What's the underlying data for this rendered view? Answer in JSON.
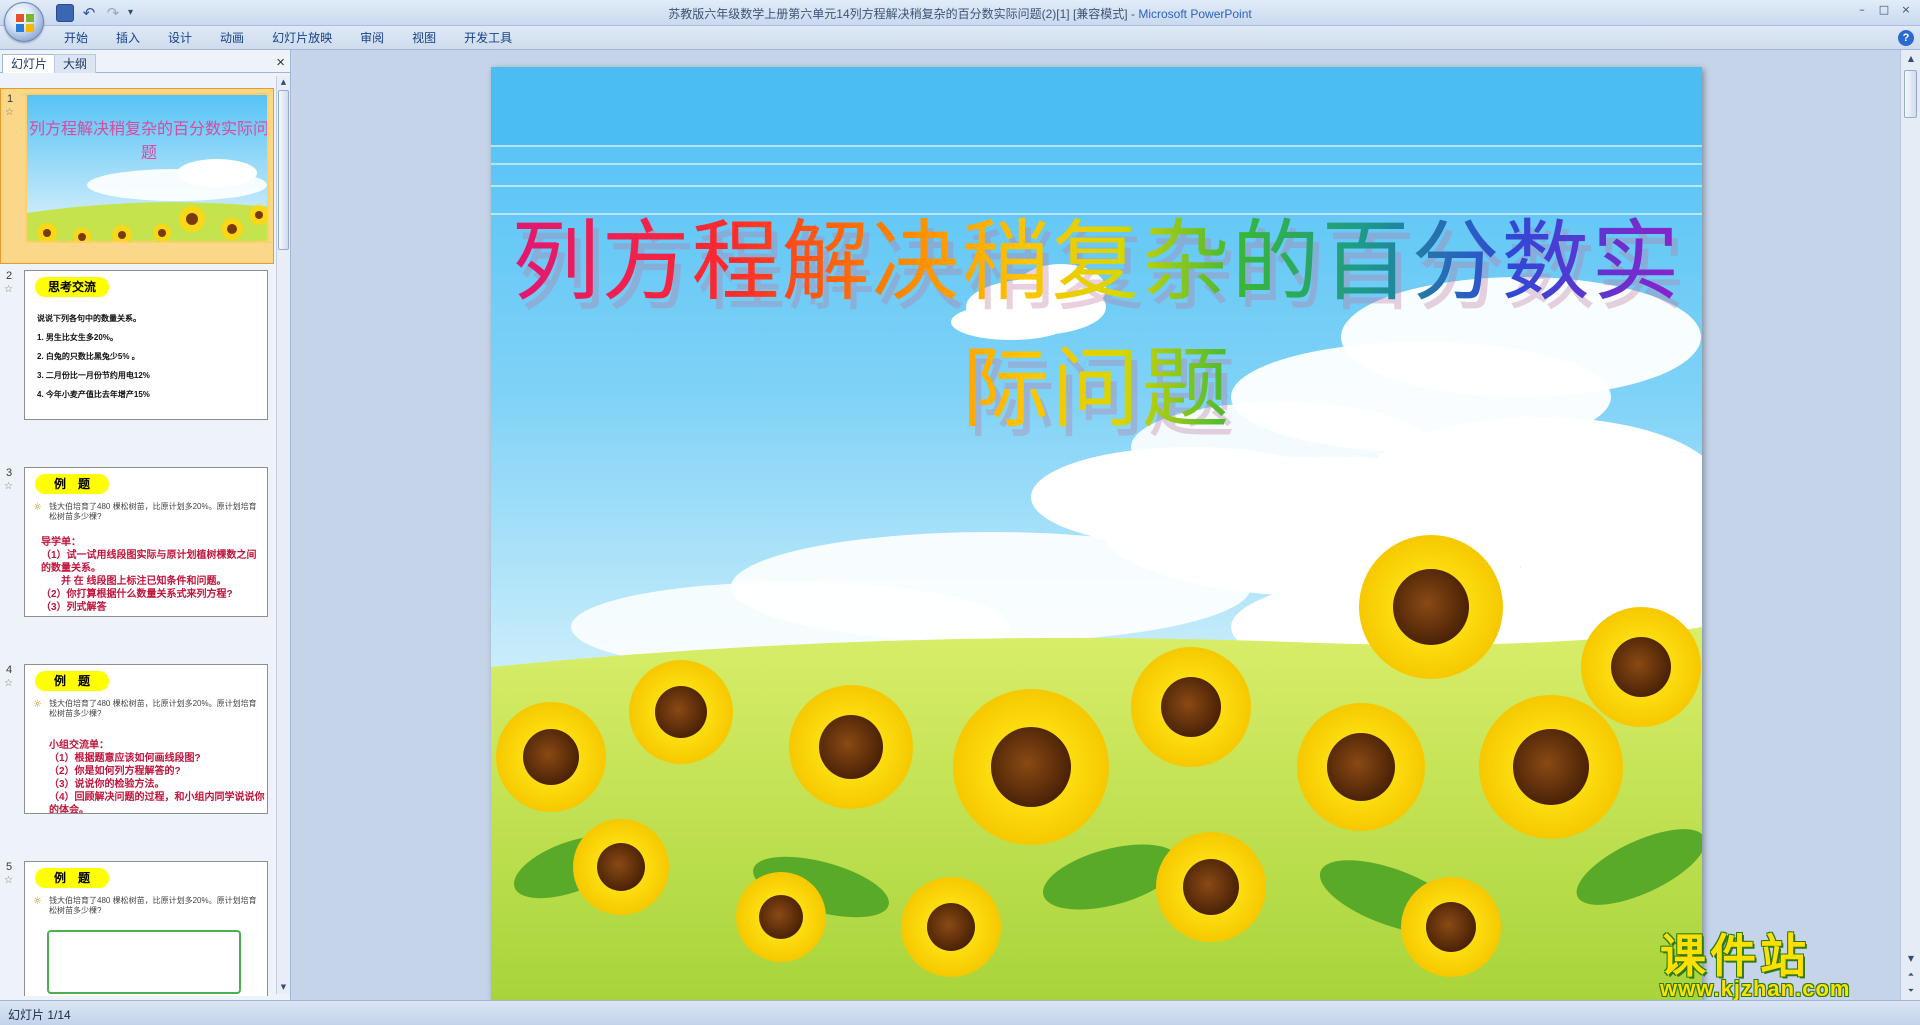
{
  "window": {
    "title": "苏教版六年级数学上册第六单元14列方程解决稍复杂的百分数实际问题(2)[1] [兼容模式]",
    "app_name": "Microsoft PowerPoint",
    "controls": [
      "–",
      "□",
      "×"
    ]
  },
  "quick_access": {
    "undo": "↶",
    "redo": "↷",
    "dropdown": "▾"
  },
  "ribbon": {
    "tabs": [
      "开始",
      "插入",
      "设计",
      "动画",
      "幻灯片放映",
      "审阅",
      "视图",
      "开发工具"
    ],
    "help": "?"
  },
  "panel": {
    "tabs": [
      "幻灯片",
      "大纲"
    ],
    "close": "×"
  },
  "thumbnails": [
    {
      "num": "1",
      "star": "☆",
      "title": "列方程解决稍复杂的百分数实际问题"
    },
    {
      "num": "2",
      "star": "☆",
      "pill": "思考交流",
      "lines": [
        "说说下列各句中的数量关系。",
        "1. 男生比女生多20%。",
        "2. 白兔的只数比黑兔少5% 。",
        "3. 二月份比一月份节约用电12%",
        "4. 今年小麦产值比去年增产15%"
      ]
    },
    {
      "num": "3",
      "star": "☆",
      "pill": "例　题",
      "problem": "钱大伯培育了480 棵松树苗，比原计划多20%。原计划培育松树苗多少棵?",
      "red": [
        "导学单：",
        "（1）试一试用线段图实际与原计划植树棵数之间的数量关系。",
        "　　并 在 线段图上标注已知条件和问题。",
        "（2）你打算根据什么数量关系式来列方程?",
        "（3）列式解答"
      ]
    },
    {
      "num": "4",
      "star": "☆",
      "pill": "例　题",
      "problem": "钱大伯培育了480 棵松树苗，比原计划多20%。原计划培育松树苗多少棵?",
      "red": [
        "小组交流单：",
        "（1）根据题意应该如何画线段图?",
        "（2）你是如何列方程解答的?",
        "（3）说说你的检验方法。",
        "（4）回顾解决问题的过程，和小组内同学说说你的体会。"
      ]
    },
    {
      "num": "5",
      "star": "☆",
      "pill": "例　题",
      "problem": "钱大伯培育了480 棵松树苗，比原计划多20%。原计划培育松树苗多少棵?"
    }
  ],
  "slide": {
    "title": "列方程解决稍复杂的百分数实际问题"
  },
  "status": {
    "slide_indicator": "幻灯片 1/14"
  },
  "watermark": {
    "brand": "课件站",
    "url": "www.kjzhan.com"
  }
}
